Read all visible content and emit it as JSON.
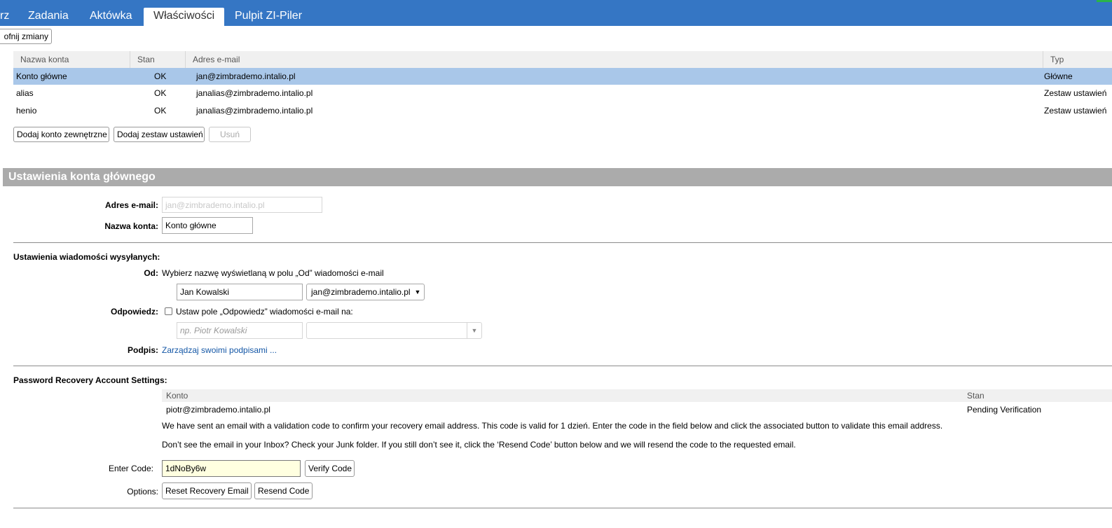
{
  "tabs": [
    {
      "label": "rz"
    },
    {
      "label": "Zadania"
    },
    {
      "label": "Aktówka"
    },
    {
      "label": "Właściwości"
    },
    {
      "label": "Pulpit ZI-Piler"
    }
  ],
  "toolbar": {
    "undo_label": "ofnij zmiany"
  },
  "accounts_table": {
    "headers": [
      "Nazwa konta",
      "Stan",
      "Adres e-mail",
      "Typ"
    ],
    "rows": [
      {
        "name": "Konto główne",
        "status": "OK",
        "email": "jan@zimbrademo.intalio.pl",
        "type": "Główne"
      },
      {
        "name": "alias",
        "status": "OK",
        "email": "janalias@zimbrademo.intalio.pl",
        "type": "Zestaw ustawień"
      },
      {
        "name": "henio",
        "status": "OK",
        "email": "janalias@zimbrademo.intalio.pl",
        "type": "Zestaw ustawień"
      }
    ]
  },
  "account_buttons": {
    "add_external": "Dodaj konto zewnętrzne",
    "add_persona": "Dodaj zestaw ustawień",
    "delete": "Usuń"
  },
  "main_account_settings": {
    "header": "Ustawienia konta głównego",
    "email_label": "Adres e-mail:",
    "email_value": "jan@zimbrademo.intalio.pl",
    "account_name_label": "Nazwa konta:",
    "account_name_value": "Konto główne"
  },
  "sent_settings": {
    "title": "Ustawienia wiadomości wysyłanych:",
    "from_label": "Od:",
    "from_description": "Wybierz nazwę wyświetlaną w polu „Od” wiadomości e-mail",
    "from_name_value": "Jan Kowalski",
    "from_address_value": "jan@zimbrademo.intalio.pl",
    "reply_label": "Odpowiedz:",
    "reply_checkbox_label": "Ustaw pole „Odpowiedz” wiadomości e-mail na:",
    "reply_checked": false,
    "reply_name_placeholder": "np. Piotr Kowalski",
    "signature_label": "Podpis:",
    "signature_link": "Zarządzaj swoimi podpisami ..."
  },
  "password_recovery": {
    "title": "Password Recovery Account Settings:",
    "headers": [
      "Konto",
      "Stan"
    ],
    "account": "piotr@zimbrademo.intalio.pl",
    "status": "Pending Verification",
    "info_1": "We have sent an email with a validation code to confirm your recovery email address. This code is valid for 1 dzień. Enter the code in the field below and click the associated button to validate this email address.",
    "info_2": "Don’t see the email in your Inbox? Check your Junk folder. If you still don’t see it, click the ‘Resend Code’ button below and we will resend the code to the requested email.",
    "enter_code_label": "Enter Code:",
    "code_value": "1dNoBy6w",
    "verify_button": "Verify Code",
    "options_label": "Options:",
    "reset_button": "Reset Recovery Email",
    "resend_button": "Resend Code"
  },
  "colors": {
    "tabbar": "#3576c4",
    "selected_row": "#a9c7e9",
    "section_header": "#ababab",
    "link": "#1457a6",
    "code_field_bg": "#ffffe0"
  }
}
